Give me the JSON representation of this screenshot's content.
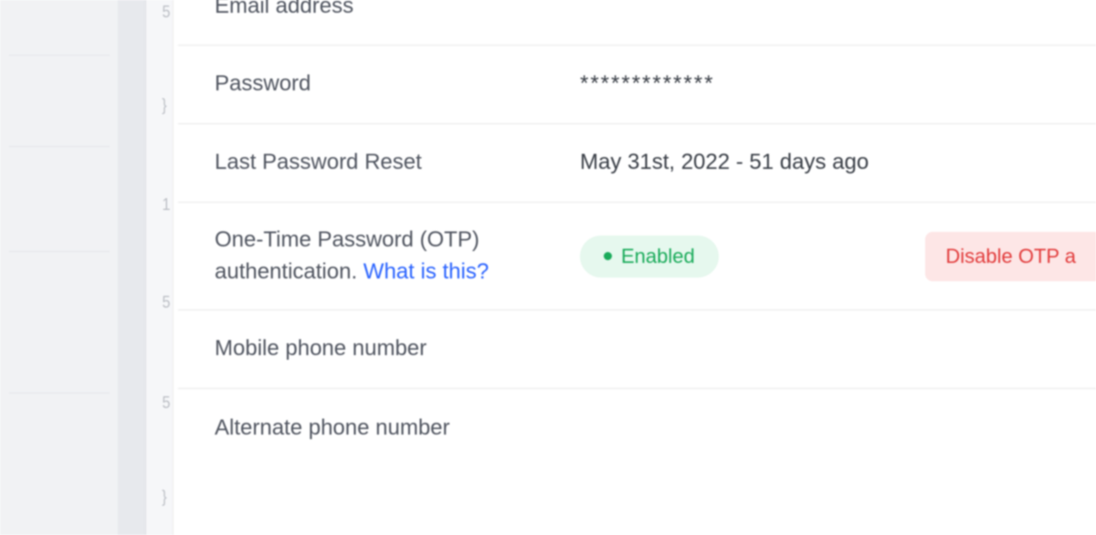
{
  "rows": {
    "email": {
      "label": "Email address",
      "value": ""
    },
    "password": {
      "label": "Password",
      "value": "*************"
    },
    "last_reset": {
      "label": "Last Password Reset",
      "value": "May 31st, 2022 - 51 days ago"
    },
    "otp": {
      "label_part1": "One-Time Password (OTP) authentication. ",
      "help_link": "What is this?",
      "status_text": "Enabled",
      "disable_button": "Disable OTP a"
    },
    "mobile": {
      "label": "Mobile phone number",
      "value": ""
    },
    "alternate": {
      "label": "Alternate phone number",
      "value": ""
    }
  }
}
